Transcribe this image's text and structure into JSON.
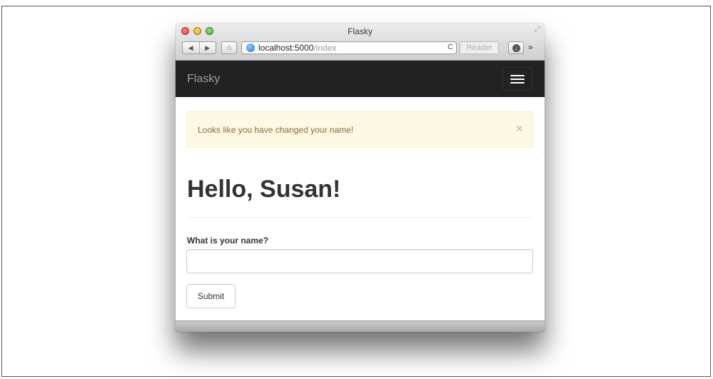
{
  "browser": {
    "window_title": "Flasky",
    "back_glyph": "◀",
    "forward_glyph": "▶",
    "home_glyph": "⌂",
    "url_host": "localhost:5000",
    "url_path": "/index",
    "reload_glyph": "C",
    "reader_label": "Reader",
    "download_glyph": "↓",
    "more_glyph": "»"
  },
  "navbar": {
    "brand": "Flasky"
  },
  "alert": {
    "message": "Looks like you have changed your name!",
    "close_glyph": "×",
    "colors": {
      "background": "#fcf8e3",
      "border": "#faebcc",
      "text": "#8a6d3b"
    }
  },
  "page": {
    "heading": "Hello, Susan!"
  },
  "form": {
    "name_label": "What is your name?",
    "name_value": "",
    "submit_label": "Submit"
  },
  "icons": [
    "close-light-icon",
    "minimize-light-icon",
    "zoom-light-icon",
    "resize-icon",
    "back-arrow-icon",
    "forward-arrow-icon",
    "home-icon",
    "globe-icon",
    "reload-icon",
    "download-icon",
    "more-chevron-icon",
    "hamburger-menu-icon",
    "close-x-icon"
  ],
  "colors": {
    "navbar": "#222222",
    "brand_text": "#9d9d9d",
    "heading": "#333333"
  }
}
